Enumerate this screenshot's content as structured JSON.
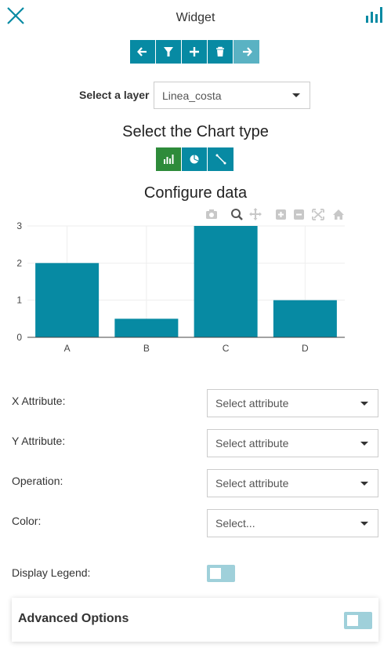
{
  "header": {
    "title": "Widget",
    "close_icon": "close-icon",
    "chart_icon": "bar-chart-icon",
    "accent": "#078aa3"
  },
  "toolbar": {
    "buttons": [
      "arrow-left-icon",
      "filter-icon",
      "plus-icon",
      "trash-icon",
      "arrow-right-icon"
    ]
  },
  "layer": {
    "label": "Select a layer",
    "value": "Linea_costa"
  },
  "chart_type": {
    "title": "Select the Chart type",
    "options": [
      "bar-chart-icon",
      "pie-chart-icon",
      "line-chart-icon"
    ],
    "selected": "bar"
  },
  "configure": {
    "title": "Configure data"
  },
  "chart_data": {
    "type": "bar",
    "categories": [
      "A",
      "B",
      "C",
      "D"
    ],
    "values": [
      2,
      0.5,
      3,
      1
    ],
    "yticks": [
      0,
      1,
      2,
      3
    ],
    "ylim": [
      0,
      3
    ],
    "color": "#078aa3",
    "grid": true
  },
  "modebar": [
    "camera-icon",
    "zoom-icon",
    "pan-icon",
    "zoom-in-icon",
    "zoom-out-icon",
    "autoscale-icon",
    "home-icon"
  ],
  "form": {
    "x_attribute": {
      "label": "X Attribute:",
      "placeholder": "Select attribute"
    },
    "y_attribute": {
      "label": "Y Attribute:",
      "placeholder": "Select attribute"
    },
    "operation": {
      "label": "Operation:",
      "placeholder": "Select attribute"
    },
    "color": {
      "label": "Color:",
      "placeholder": "Select..."
    },
    "legend": {
      "label": "Display Legend:",
      "enabled": false
    }
  },
  "advanced": {
    "label": "Advanced Options",
    "enabled": false
  }
}
